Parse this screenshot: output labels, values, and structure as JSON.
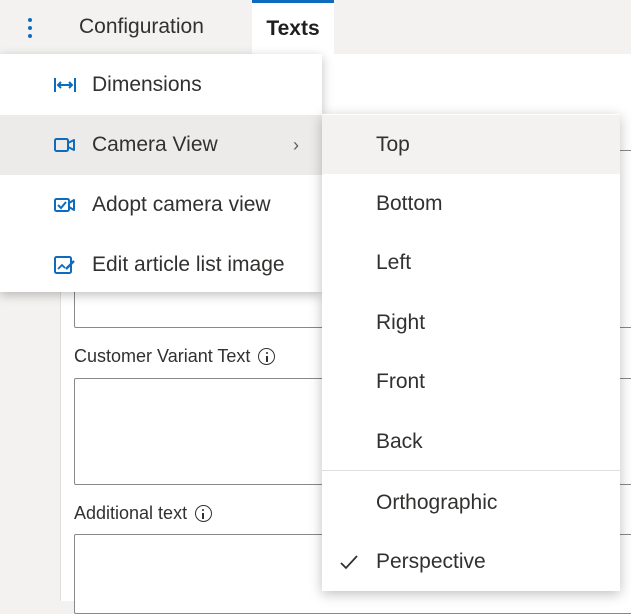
{
  "tabs": {
    "configuration": "Configuration",
    "texts": "Texts"
  },
  "form": {
    "customer_variant_label": "Customer Variant Text",
    "additional_text_label": "Additional text"
  },
  "menu": {
    "items": [
      {
        "label": "Dimensions",
        "icon": "dimensions-icon"
      },
      {
        "label": "Camera View",
        "icon": "camera-icon",
        "has_submenu": true
      },
      {
        "label": "Adopt camera view",
        "icon": "adopt-camera-icon"
      },
      {
        "label": "Edit article list image",
        "icon": "edit-image-icon"
      }
    ]
  },
  "submenu": {
    "views": [
      "Top",
      "Bottom",
      "Left",
      "Right",
      "Front",
      "Back"
    ],
    "projections": [
      "Orthographic",
      "Perspective"
    ],
    "selected_projection": "Perspective",
    "highlighted": "Top"
  },
  "colors": {
    "accent": "#0f6cbd",
    "text": "#323130",
    "hover": "#edebe9"
  }
}
